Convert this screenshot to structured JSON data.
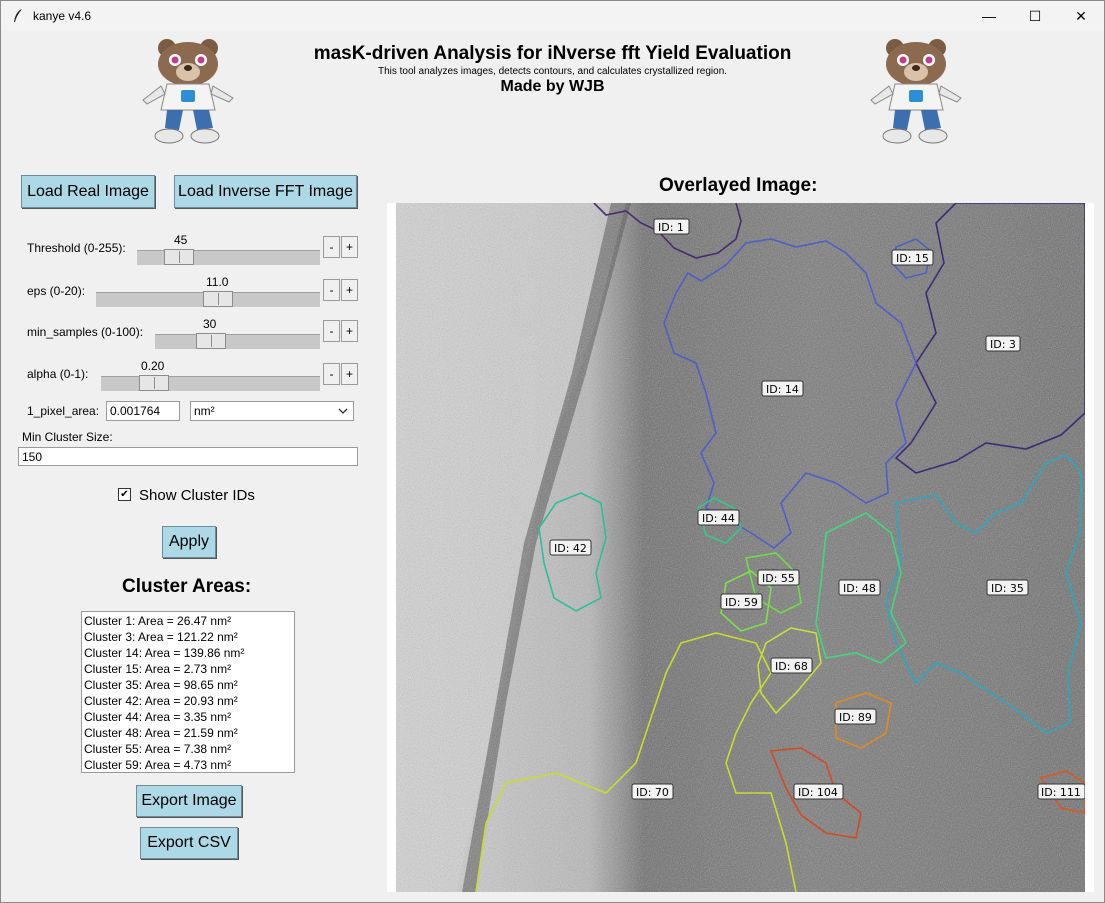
{
  "window": {
    "title": "kanye v4.6",
    "minimize": "—",
    "maximize": "☐",
    "close": "✕"
  },
  "header": {
    "title": "masK-driven Analysis for iNverse fft Yield Evaluation",
    "subtitle": "This tool analyzes images, detects contours, and calculates crystallized region.",
    "credit": "Made by WJB"
  },
  "buttons": {
    "load_real": "Load Real Image",
    "load_ifft": "Load Inverse FFT Image",
    "apply": "Apply",
    "export_image": "Export Image",
    "export_csv": "Export CSV"
  },
  "controls": {
    "threshold": {
      "label": "Threshold (0-255):",
      "value": "45",
      "fraction": 0.176
    },
    "eps": {
      "label": "eps (0-20):",
      "value": "11.0",
      "fraction": 0.55
    },
    "min_samples": {
      "label": "min_samples (0-100):",
      "value": "30",
      "fraction": 0.3
    },
    "alpha": {
      "label": "alpha (0-1):",
      "value": "0.20",
      "fraction": 0.2
    },
    "minus": "-",
    "plus": "+",
    "pixel_area": {
      "label": "1_pixel_area:",
      "value": "0.001764",
      "unit": "nm²"
    },
    "min_cluster": {
      "label": "Min Cluster Size:",
      "value": "150"
    },
    "show_ids": {
      "label": "Show Cluster IDs",
      "checked": true,
      "check_glyph": "✔"
    }
  },
  "cluster_areas": {
    "heading": "Cluster Areas:",
    "items": [
      "Cluster 1: Area = 26.47 nm²",
      "Cluster 3: Area = 121.22 nm²",
      "Cluster 14: Area = 139.86 nm²",
      "Cluster 15: Area = 2.73 nm²",
      "Cluster 35: Area = 98.65 nm²",
      "Cluster 42: Area = 20.93 nm²",
      "Cluster 44: Area = 3.35 nm²",
      "Cluster 48: Area = 21.59 nm²",
      "Cluster 55: Area = 7.38 nm²",
      "Cluster 59: Area = 4.73 nm²"
    ]
  },
  "overlay": {
    "heading": "Overlayed Image:",
    "cluster_ids": [
      "ID: 1",
      "ID: 15",
      "ID: 3",
      "ID: 14",
      "ID: 44",
      "ID: 42",
      "ID: 55",
      "ID: 48",
      "ID: 35",
      "ID: 59",
      "ID: 68",
      "ID: 89",
      "ID: 70",
      "ID: 104",
      "ID: 111"
    ],
    "colors": {
      "c1": "#4b2a6e",
      "c3": "#3d2b78",
      "c14": "#4f5fc9",
      "c15": "#4a62c8",
      "c35": "#2aa8c0",
      "c42": "#2dbf9a",
      "c44": "#33c98a",
      "c48": "#3fd87a",
      "c55": "#6ddc4a",
      "c59": "#7ee04a",
      "c68": "#c8e03a",
      "c70": "#c9dc2e",
      "c89": "#e08a20",
      "c104": "#d44a20",
      "c111": "#d85a20"
    }
  }
}
